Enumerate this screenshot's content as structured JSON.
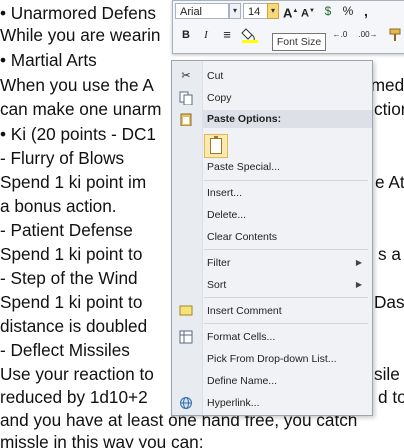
{
  "cell_text": [
    "• Unarmored Defens",
    "  While you are wearin",
    "• Martial Arts",
    "  When you use the A",
    "  can make one unarm",
    "• Ki (20 points - DC1",
    "- Flurry of Blows",
    "  Spend 1 ki point im",
    "  a bonus action.",
    "- Patient Defense",
    "  Spend 1 ki point to",
    "- Step of the Wind",
    "  Spend 1 ki point to",
    "  distance is doubled",
    "- Deflect Missiles",
    "  Use your reaction to",
    "  reduced by 1d10+2",
    "  and you have at least one hand free, you catch",
    "  missle in this way you can:"
  ],
  "cell_text_right": [
    {
      "row": 3,
      "text": "rmed"
    },
    {
      "row": 4,
      "text": "ction"
    },
    {
      "row": 7,
      "text": "e At"
    },
    {
      "row": 10,
      "text": "s a"
    },
    {
      "row": 12,
      "text": "Dash"
    },
    {
      "row": 15,
      "text": "sile w"
    },
    {
      "row": 16,
      "text": "d to"
    }
  ],
  "mini_toolbar": {
    "font_name": "Arial",
    "font_size": "14",
    "grow_font": "A",
    "shrink_font": "A",
    "currency": "$",
    "percent": "%",
    "comma": ",",
    "bold": "B",
    "italic": "I",
    "align": "≡",
    "increase_decimal": "←.0",
    "decrease_decimal": ".00→"
  },
  "tooltip": "Font Size",
  "context_menu": {
    "cut": "Cut",
    "copy": "Copy",
    "paste_options": "Paste Options:",
    "paste_special": "Paste Special...",
    "insert": "Insert...",
    "delete": "Delete...",
    "clear_contents": "Clear Contents",
    "filter": "Filter",
    "sort": "Sort",
    "insert_comment": "Insert Comment",
    "format_cells": "Format Cells...",
    "pick_from_list": "Pick From Drop-down List...",
    "define_name": "Define Name...",
    "hyperlink": "Hyperlink..."
  }
}
